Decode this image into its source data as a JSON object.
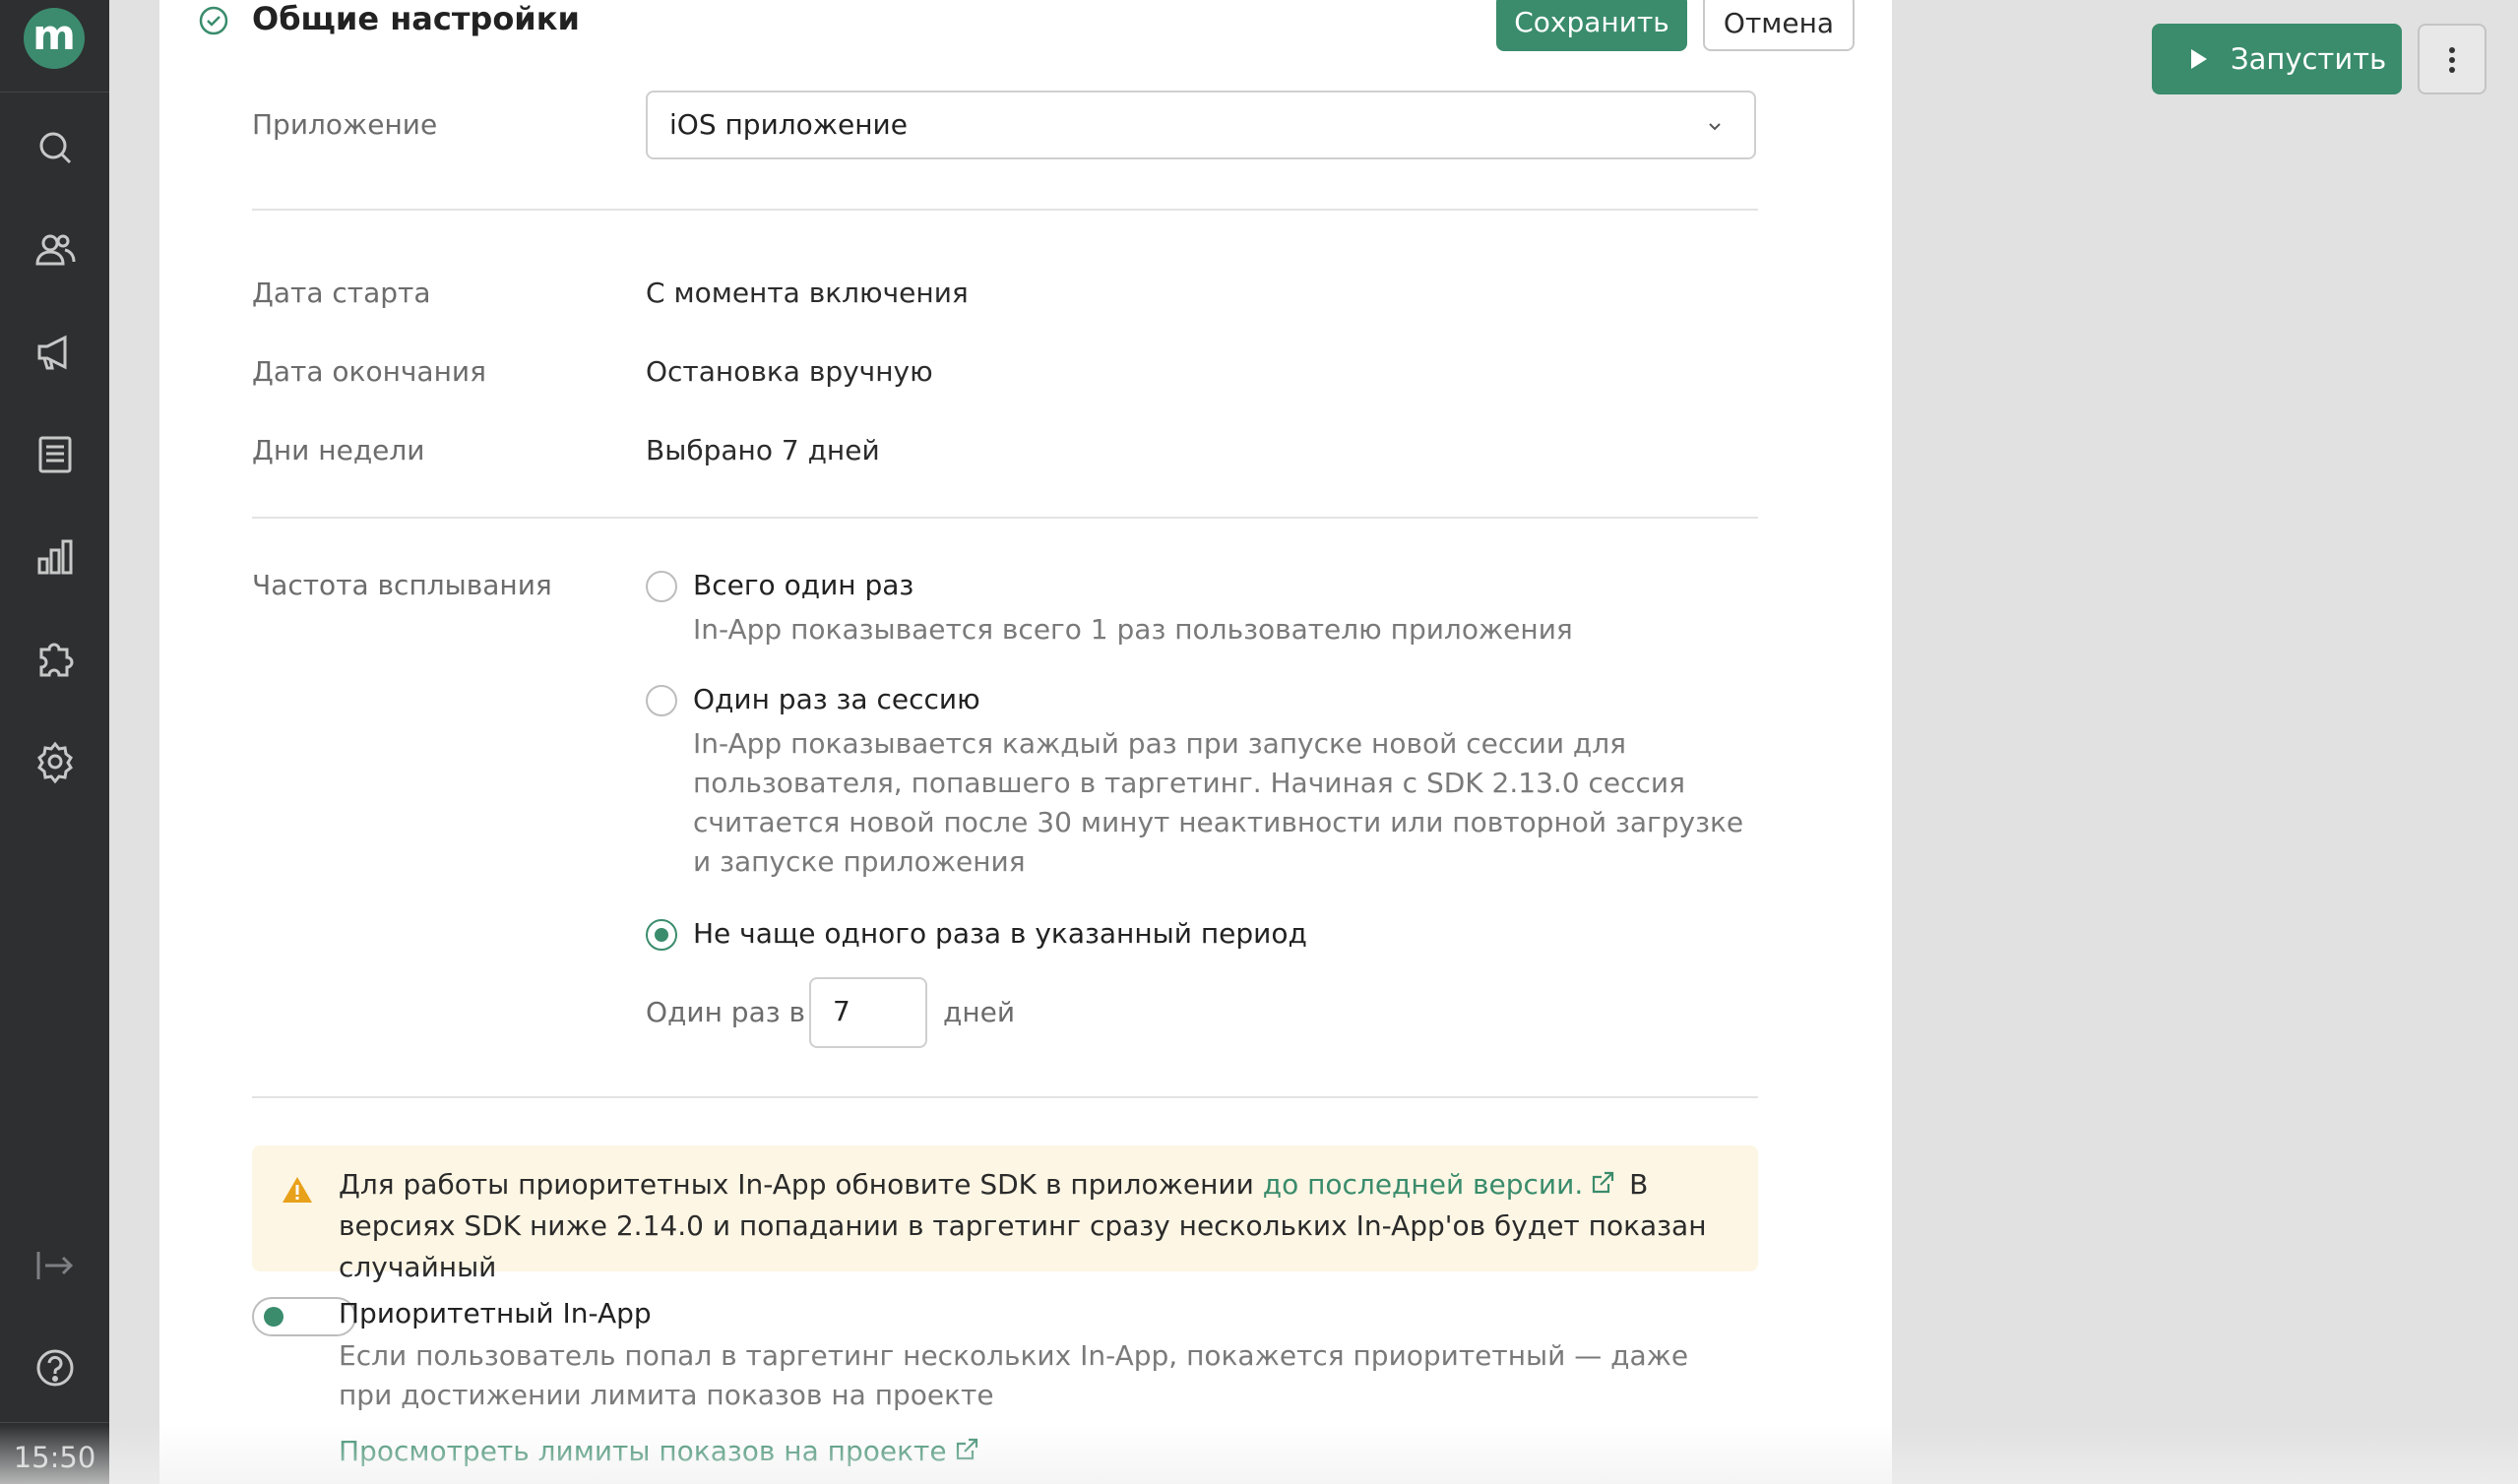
{
  "sidebar": {
    "logo_letter": "m",
    "nav": [
      "search-icon",
      "users-icon",
      "megaphone-icon",
      "document-list-icon",
      "bar-chart-icon",
      "puzzle-icon",
      "gear-icon"
    ],
    "bottom": [
      "collapse-icon",
      "help-icon"
    ],
    "clock": "15:50"
  },
  "header": {
    "title": "Общие настройки",
    "save_label": "Сохранить",
    "cancel_label": "Отмена"
  },
  "toolbar": {
    "run_label": "Запустить"
  },
  "form": {
    "app_label": "Приложение",
    "app_value": "iOS приложение",
    "start_label": "Дата старта",
    "start_value": "С момента включения",
    "end_label": "Дата окончания",
    "end_value": "Остановка вручную",
    "days_label": "Дни недели",
    "days_value": "Выбрано 7 дней",
    "freq_label": "Частота всплывания",
    "options": [
      {
        "title": "Всего один раз",
        "desc": "In-App показывается всего 1 раз пользователю приложения",
        "selected": false
      },
      {
        "title": "Один раз за сессию",
        "desc": "In-App показывается каждый раз при запуске новой сессии для пользователя, попавшего в таргетинг. Начиная с SDK 2.13.0 сессия считается новой после 30 минут неактивности или повторной загрузке и запуске приложения",
        "selected": false
      },
      {
        "title": "Не чаще одного раза в указанный период",
        "selected": true
      }
    ],
    "period_prefix": "Один раз в",
    "period_value": "7",
    "period_suffix": "дней"
  },
  "warning": {
    "text_before": "Для работы приоритетных In-App обновите SDK в приложении ",
    "link": "до последней версии.",
    "text_after": " В версиях SDK ниже 2.14.0 и попадании в таргетинг сразу нескольких In-App'ов будет показан случайный",
    "color": "#e8a11a"
  },
  "priority": {
    "title": "Приоритетный In-App",
    "desc": "Если пользователь попал в таргетинг нескольких In-App, покажется приоритетный — даже при достижении лимита показов на проекте",
    "link": "Просмотреть лимиты показов на проекте",
    "enabled": false
  },
  "colors": {
    "accent": "#3a8c6c",
    "sidebar": "#2e2f31",
    "warning_bg": "#fdf6e4"
  }
}
